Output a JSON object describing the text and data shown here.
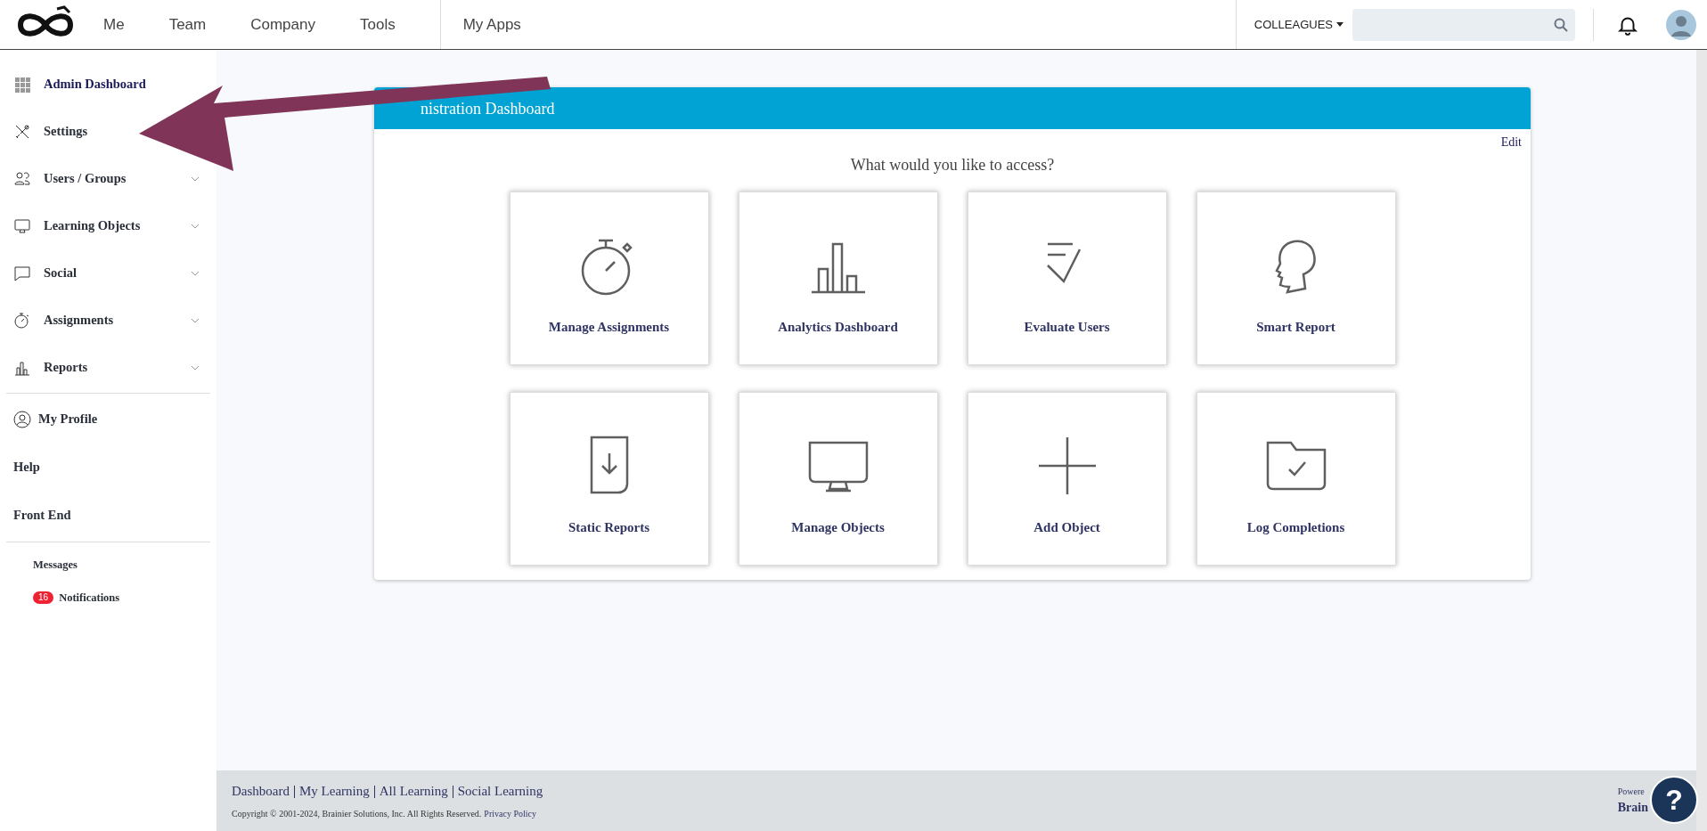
{
  "top_nav": {
    "items": [
      {
        "label": "Me"
      },
      {
        "label": "Team"
      },
      {
        "label": "Company"
      },
      {
        "label": "Tools"
      },
      {
        "label": "My Apps"
      }
    ],
    "colleagues": "COLLEAGUES"
  },
  "sidebar": {
    "items": [
      {
        "label": "Admin Dashboard",
        "selected": true
      },
      {
        "label": "Settings",
        "selected": false
      },
      {
        "label": "Users / Groups",
        "selected": false,
        "expanded": false
      },
      {
        "label": "Learning Objects",
        "selected": false,
        "expanded": false
      },
      {
        "label": "Social",
        "selected": false,
        "expanded": false
      },
      {
        "label": "Assignments",
        "selected": false,
        "expanded": false
      },
      {
        "label": "Reports",
        "selected": false,
        "expanded": false
      }
    ],
    "links": [
      "My Profile",
      "Help",
      "Front End"
    ],
    "messages": "Messages",
    "notifications": {
      "label": "Notifications",
      "count": "16"
    }
  },
  "panel": {
    "title": "nistration Dashboard",
    "edit": "Edit",
    "prompt": "What would you like to access?",
    "tiles": [
      {
        "label": "Manage Assignments"
      },
      {
        "label": "Analytics Dashboard"
      },
      {
        "label": "Evaluate Users"
      },
      {
        "label": "Smart Report"
      },
      {
        "label": "Static Reports"
      },
      {
        "label": "Manage Objects"
      },
      {
        "label": "Add Object"
      },
      {
        "label": "Log Completions"
      }
    ]
  },
  "footer": {
    "links": [
      "Dashboard",
      "My Learning",
      "All Learning",
      "Social Learning"
    ],
    "copyright": "Copyright © 2001-2024, Brainier Solutions, Inc. All Rights Reserved.",
    "privacy": "Privacy Policy",
    "powered": "Powere",
    "brand": "Brain",
    "help": "?"
  }
}
